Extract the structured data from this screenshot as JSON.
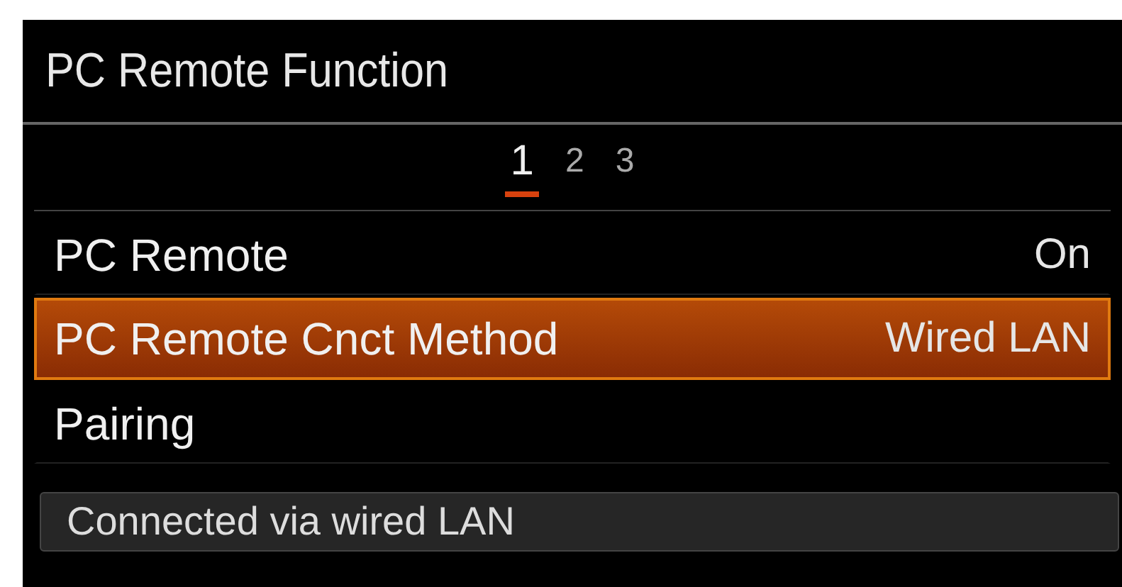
{
  "window": {
    "title": "PC Remote Function"
  },
  "pages": [
    {
      "label": "1",
      "selected": true
    },
    {
      "label": "2",
      "selected": false
    },
    {
      "label": "3",
      "selected": false
    }
  ],
  "items": [
    {
      "label": "PC Remote",
      "value": "On",
      "selected": false
    },
    {
      "label": "PC Remote Cnct Method",
      "value": "Wired LAN",
      "selected": true
    },
    {
      "label": "Pairing",
      "selected": false
    }
  ],
  "help_text": "Connected via wired LAN"
}
